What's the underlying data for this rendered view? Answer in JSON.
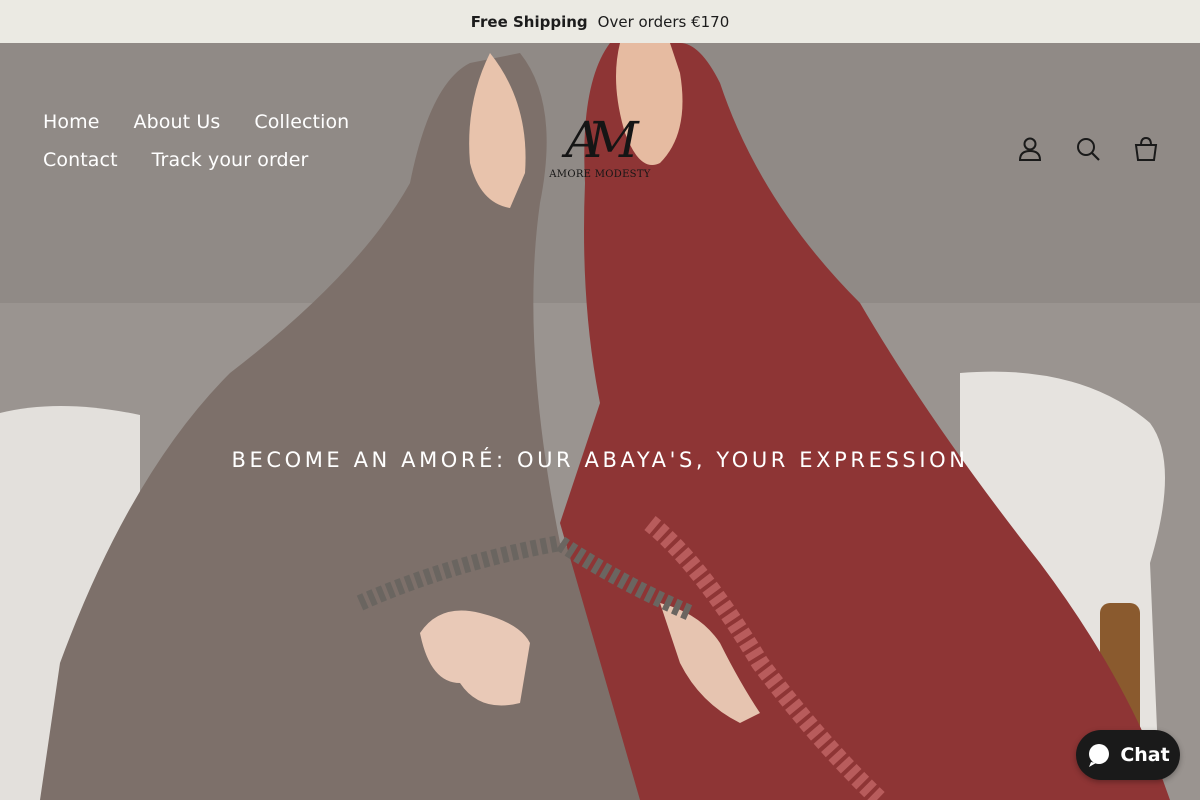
{
  "announcement": {
    "bold": "Free Shipping",
    "text": "Over orders €170"
  },
  "nav": {
    "items": [
      "Home",
      "About Us",
      "Collection",
      "Contact",
      "Track your order"
    ]
  },
  "logo": {
    "mark": "AM",
    "wordmark": "AMORE MODESTY"
  },
  "header_icons": [
    "user-icon",
    "search-icon",
    "cart-icon"
  ],
  "hero": {
    "title": "BECOME AN AMORÉ: OUR ABAYA'S, YOUR EXPRESSION"
  },
  "chat": {
    "label": "Chat"
  },
  "colors": {
    "announcement_bg": "#ebeae3",
    "taupe_abaya": "#7d706a",
    "red_abaya": "#8e3535",
    "chat_bg": "#1a1a1a"
  }
}
